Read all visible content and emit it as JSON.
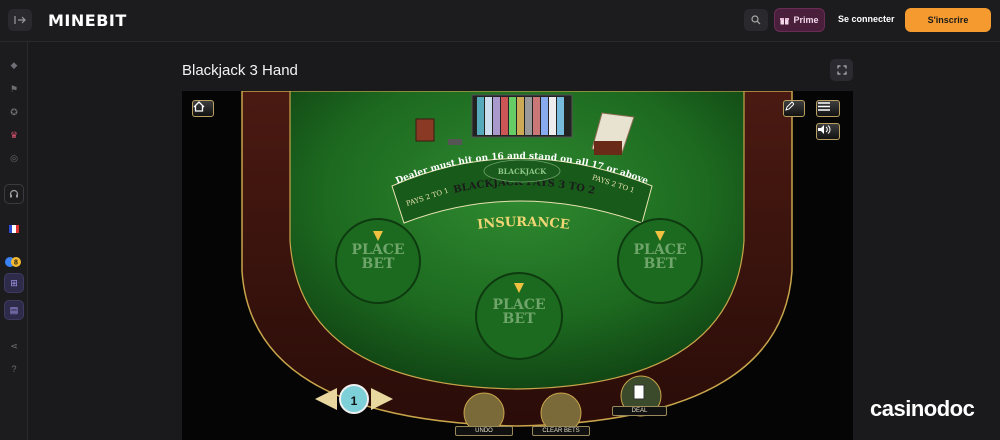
{
  "header": {
    "logo": "MINEBIT",
    "prime_label": "Prime",
    "login_label": "Se connecter",
    "signup_label": "S'inscrire"
  },
  "sidebar": {
    "icons": [
      "poker-chip-icon",
      "flag-icon",
      "trophy-icon",
      "crown-icon",
      "casino-chip-icon",
      "headset-icon",
      "language-flag-fr",
      "coin-stack-icon",
      "shop-cart-icon",
      "document-icon",
      "share-icon",
      "help-icon"
    ],
    "coin_badge": "8"
  },
  "page": {
    "title": "Blackjack 3 Hand"
  },
  "game": {
    "table_texts": {
      "brand_plaque": "BLACKJACK",
      "payout_line": "BLACKJACK PAYS 3 TO 2",
      "dealer_rule": "Dealer must hit on 16 and stand on all 17 or above",
      "insurance_left": "PAYS 2 TO 1",
      "insurance_right": "PAYS 2 TO 1",
      "insurance": "INSURANCE"
    },
    "place_bet_labels": [
      "PLACE BET",
      "PLACE BET",
      "PLACE BET"
    ],
    "chip_value": "1",
    "actions": {
      "undo": "UNDO",
      "clear_bets": "CLEAR BETS",
      "deal": "DEAL"
    },
    "colors": {
      "felt": "#1f6a22",
      "rail": "#5a1c12",
      "trim": "#c8a54a"
    }
  },
  "watermark": "casinodoc"
}
